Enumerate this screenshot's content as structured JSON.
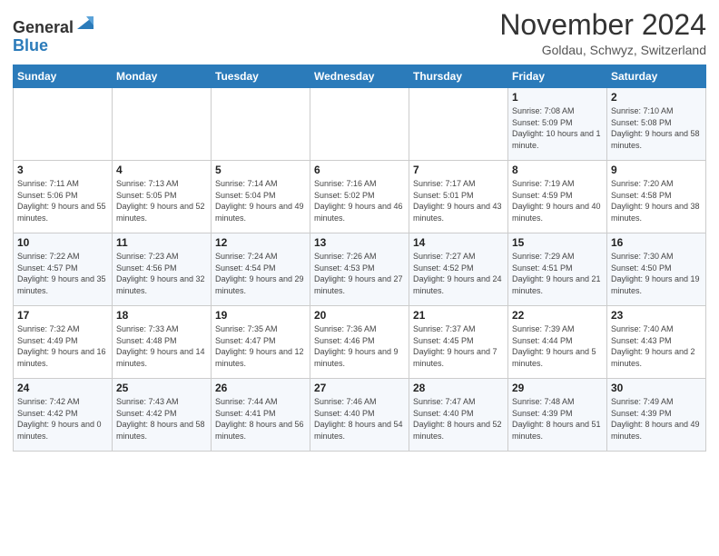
{
  "header": {
    "logo_line1": "General",
    "logo_line2": "Blue",
    "month": "November 2024",
    "location": "Goldau, Schwyz, Switzerland"
  },
  "weekdays": [
    "Sunday",
    "Monday",
    "Tuesday",
    "Wednesday",
    "Thursday",
    "Friday",
    "Saturday"
  ],
  "weeks": [
    [
      {
        "day": "",
        "info": ""
      },
      {
        "day": "",
        "info": ""
      },
      {
        "day": "",
        "info": ""
      },
      {
        "day": "",
        "info": ""
      },
      {
        "day": "",
        "info": ""
      },
      {
        "day": "1",
        "info": "Sunrise: 7:08 AM\nSunset: 5:09 PM\nDaylight: 10 hours\nand 1 minute."
      },
      {
        "day": "2",
        "info": "Sunrise: 7:10 AM\nSunset: 5:08 PM\nDaylight: 9 hours\nand 58 minutes."
      }
    ],
    [
      {
        "day": "3",
        "info": "Sunrise: 7:11 AM\nSunset: 5:06 PM\nDaylight: 9 hours\nand 55 minutes."
      },
      {
        "day": "4",
        "info": "Sunrise: 7:13 AM\nSunset: 5:05 PM\nDaylight: 9 hours\nand 52 minutes."
      },
      {
        "day": "5",
        "info": "Sunrise: 7:14 AM\nSunset: 5:04 PM\nDaylight: 9 hours\nand 49 minutes."
      },
      {
        "day": "6",
        "info": "Sunrise: 7:16 AM\nSunset: 5:02 PM\nDaylight: 9 hours\nand 46 minutes."
      },
      {
        "day": "7",
        "info": "Sunrise: 7:17 AM\nSunset: 5:01 PM\nDaylight: 9 hours\nand 43 minutes."
      },
      {
        "day": "8",
        "info": "Sunrise: 7:19 AM\nSunset: 4:59 PM\nDaylight: 9 hours\nand 40 minutes."
      },
      {
        "day": "9",
        "info": "Sunrise: 7:20 AM\nSunset: 4:58 PM\nDaylight: 9 hours\nand 38 minutes."
      }
    ],
    [
      {
        "day": "10",
        "info": "Sunrise: 7:22 AM\nSunset: 4:57 PM\nDaylight: 9 hours\nand 35 minutes."
      },
      {
        "day": "11",
        "info": "Sunrise: 7:23 AM\nSunset: 4:56 PM\nDaylight: 9 hours\nand 32 minutes."
      },
      {
        "day": "12",
        "info": "Sunrise: 7:24 AM\nSunset: 4:54 PM\nDaylight: 9 hours\nand 29 minutes."
      },
      {
        "day": "13",
        "info": "Sunrise: 7:26 AM\nSunset: 4:53 PM\nDaylight: 9 hours\nand 27 minutes."
      },
      {
        "day": "14",
        "info": "Sunrise: 7:27 AM\nSunset: 4:52 PM\nDaylight: 9 hours\nand 24 minutes."
      },
      {
        "day": "15",
        "info": "Sunrise: 7:29 AM\nSunset: 4:51 PM\nDaylight: 9 hours\nand 21 minutes."
      },
      {
        "day": "16",
        "info": "Sunrise: 7:30 AM\nSunset: 4:50 PM\nDaylight: 9 hours\nand 19 minutes."
      }
    ],
    [
      {
        "day": "17",
        "info": "Sunrise: 7:32 AM\nSunset: 4:49 PM\nDaylight: 9 hours\nand 16 minutes."
      },
      {
        "day": "18",
        "info": "Sunrise: 7:33 AM\nSunset: 4:48 PM\nDaylight: 9 hours\nand 14 minutes."
      },
      {
        "day": "19",
        "info": "Sunrise: 7:35 AM\nSunset: 4:47 PM\nDaylight: 9 hours\nand 12 minutes."
      },
      {
        "day": "20",
        "info": "Sunrise: 7:36 AM\nSunset: 4:46 PM\nDaylight: 9 hours\nand 9 minutes."
      },
      {
        "day": "21",
        "info": "Sunrise: 7:37 AM\nSunset: 4:45 PM\nDaylight: 9 hours\nand 7 minutes."
      },
      {
        "day": "22",
        "info": "Sunrise: 7:39 AM\nSunset: 4:44 PM\nDaylight: 9 hours\nand 5 minutes."
      },
      {
        "day": "23",
        "info": "Sunrise: 7:40 AM\nSunset: 4:43 PM\nDaylight: 9 hours\nand 2 minutes."
      }
    ],
    [
      {
        "day": "24",
        "info": "Sunrise: 7:42 AM\nSunset: 4:42 PM\nDaylight: 9 hours\nand 0 minutes."
      },
      {
        "day": "25",
        "info": "Sunrise: 7:43 AM\nSunset: 4:42 PM\nDaylight: 8 hours\nand 58 minutes."
      },
      {
        "day": "26",
        "info": "Sunrise: 7:44 AM\nSunset: 4:41 PM\nDaylight: 8 hours\nand 56 minutes."
      },
      {
        "day": "27",
        "info": "Sunrise: 7:46 AM\nSunset: 4:40 PM\nDaylight: 8 hours\nand 54 minutes."
      },
      {
        "day": "28",
        "info": "Sunrise: 7:47 AM\nSunset: 4:40 PM\nDaylight: 8 hours\nand 52 minutes."
      },
      {
        "day": "29",
        "info": "Sunrise: 7:48 AM\nSunset: 4:39 PM\nDaylight: 8 hours\nand 51 minutes."
      },
      {
        "day": "30",
        "info": "Sunrise: 7:49 AM\nSunset: 4:39 PM\nDaylight: 8 hours\nand 49 minutes."
      }
    ]
  ]
}
